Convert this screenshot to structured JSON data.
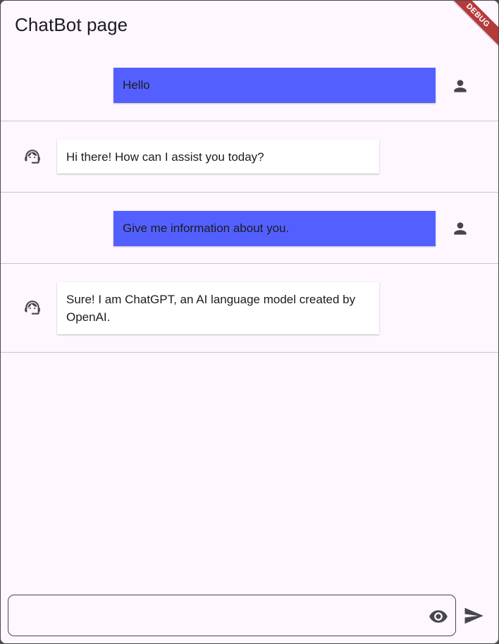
{
  "app": {
    "title": "ChatBot page",
    "debug_label": "DEBUG"
  },
  "colors": {
    "background": "#fef7ff",
    "user_bubble": "#5360ff",
    "bot_bubble": "#ffffff",
    "divider": "#cac4d0",
    "icon": "#49454f",
    "debug_banner": "#b53a3a"
  },
  "messages": [
    {
      "sender": "user",
      "text": "Hello",
      "icon": "person-icon"
    },
    {
      "sender": "bot",
      "text": "Hi there! How can I assist you today?",
      "icon": "support-agent-icon"
    },
    {
      "sender": "user",
      "text": "Give me information about you.",
      "icon": "person-icon"
    },
    {
      "sender": "bot",
      "text": "Sure! I am ChatGPT, an AI language model created by OpenAI.",
      "icon": "support-agent-icon"
    }
  ],
  "composer": {
    "value": "",
    "placeholder": "",
    "visibility_icon": "eye-icon",
    "send_icon": "send-icon"
  }
}
